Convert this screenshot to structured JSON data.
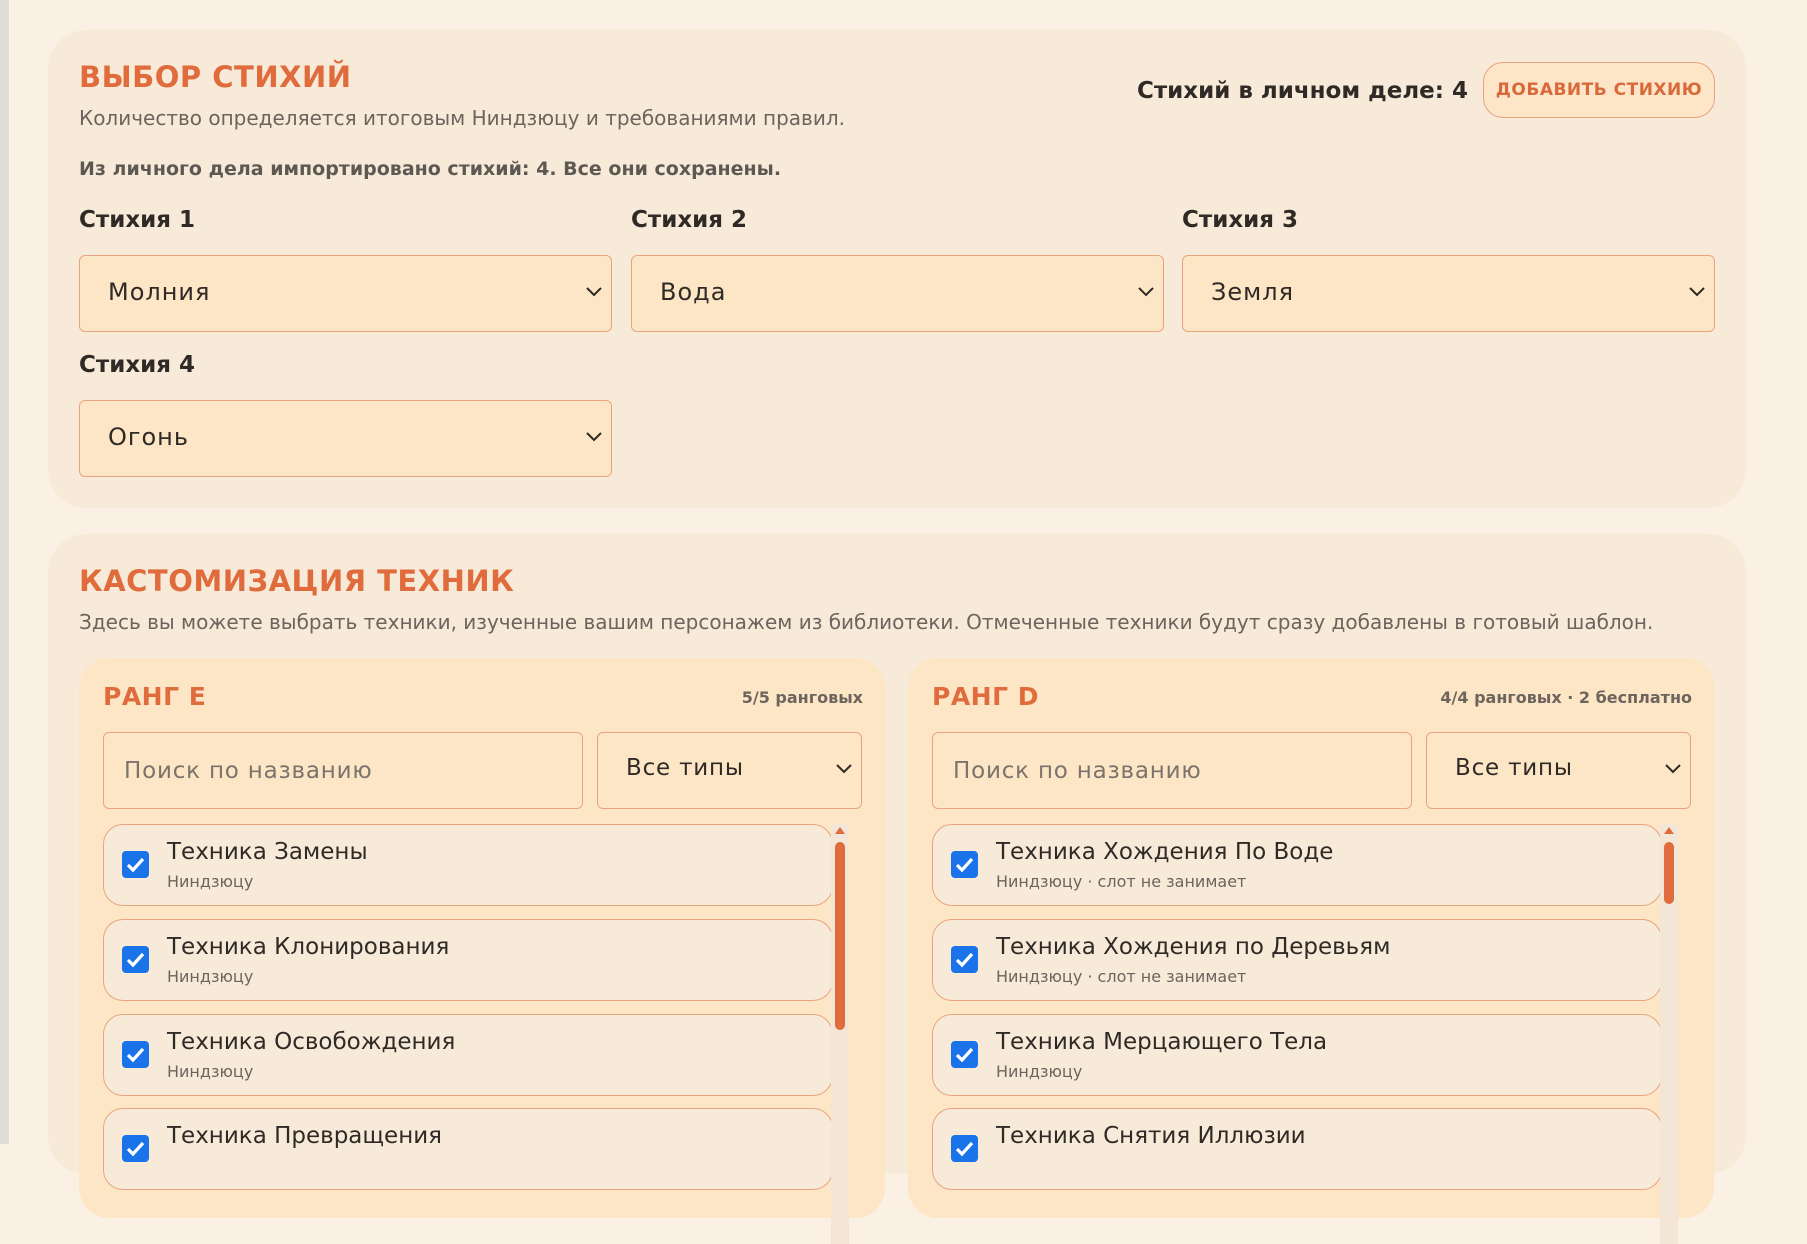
{
  "elements_section": {
    "title": "ВЫБОР СТИХИЙ",
    "subtitle": "Количество определяется итоговым Ниндзюцу и требованиями правил.",
    "count_text": "Стихий в личном деле: 4",
    "add_button": "ДОБАВИТЬ СТИХИЮ",
    "import_note": "Из личного дела импортировано стихий: 4. Все они сохранены.",
    "selects": [
      {
        "label": "Стихия 1",
        "value": "Молния"
      },
      {
        "label": "Стихия 2",
        "value": "Вода"
      },
      {
        "label": "Стихия 3",
        "value": "Земля"
      },
      {
        "label": "Стихия 4",
        "value": "Огонь"
      }
    ]
  },
  "techniques_section": {
    "title": "КАСТОМИЗАЦИЯ ТЕХНИК",
    "subtitle": "Здесь вы можете выбрать техники, изученные вашим персонажем из библиотеки. Отмеченные техники будут сразу добавлены в готовый шаблон.",
    "ranks": [
      {
        "title": "РАНГ E",
        "stat": "5/5 ранговых",
        "search_placeholder": "Поиск по названию",
        "type_filter": "Все типы",
        "items": [
          {
            "name": "Техника Замены",
            "meta": "Ниндзюцу",
            "checked": true
          },
          {
            "name": "Техника Клонирования",
            "meta": "Ниндзюцу",
            "checked": true
          },
          {
            "name": "Техника Освобождения",
            "meta": "Ниндзюцу",
            "checked": true
          },
          {
            "name": "Техника Превращения",
            "meta": "",
            "checked": true
          }
        ]
      },
      {
        "title": "РАНГ D",
        "stat": "4/4 ранговых · 2 бесплатно",
        "search_placeholder": "Поиск по названию",
        "type_filter": "Все типы",
        "items": [
          {
            "name": "Техника Хождения По Воде",
            "meta": "Ниндзюцу · слот не занимает",
            "checked": true
          },
          {
            "name": "Техника Хождения по Деревьям",
            "meta": "Ниндзюцу · слот не занимает",
            "checked": true
          },
          {
            "name": "Техника Мерцающего Тела",
            "meta": "Ниндзюцу",
            "checked": true
          },
          {
            "name": "Техника Снятия Иллюзии",
            "meta": "",
            "checked": true
          }
        ]
      }
    ]
  },
  "colors": {
    "accent": "#e06c3d",
    "panel": "#f8ead9",
    "field": "#fde6c6",
    "checkbox": "#1a73e8"
  }
}
